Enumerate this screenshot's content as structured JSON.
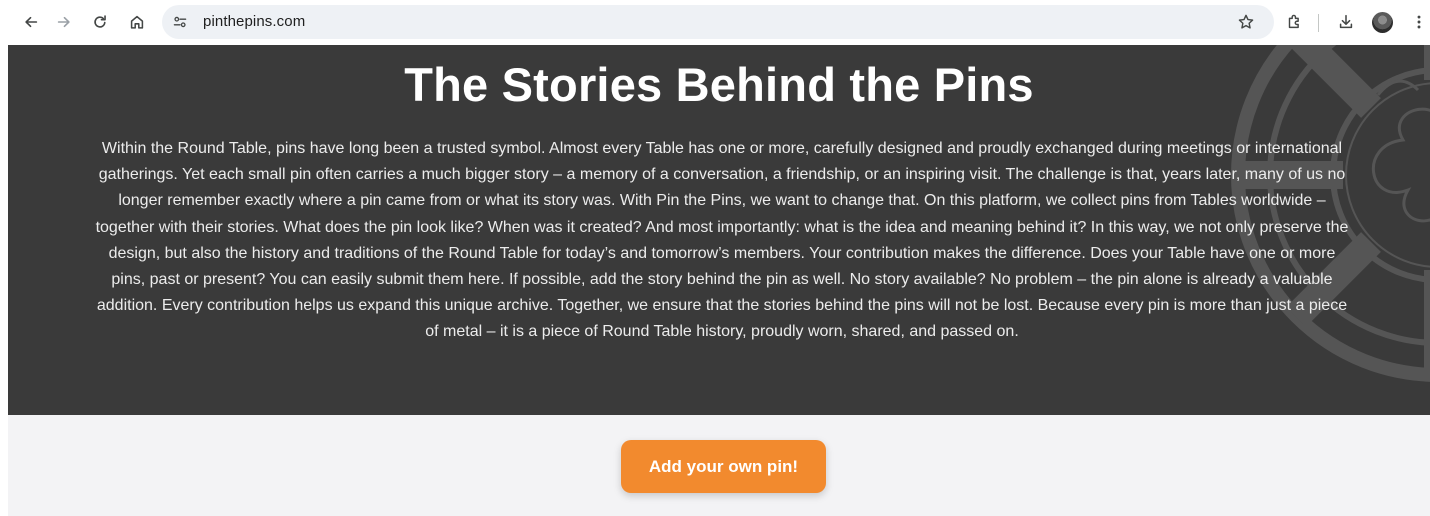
{
  "browser": {
    "url": "pinthepins.com",
    "icons": {
      "back": "arrow-left-icon",
      "forward": "arrow-right-icon",
      "reload": "reload-icon",
      "home": "home-icon",
      "site_info": "tune-icon",
      "bookmark": "star-icon",
      "extensions": "puzzle-icon",
      "downloads": "download-icon",
      "profile": "avatar",
      "menu": "kebab-menu-icon"
    }
  },
  "hero": {
    "title": "The Stories Behind the Pins",
    "body": "Within the Round Table, pins have long been a trusted symbol. Almost every Table has one or more, carefully designed and proudly exchanged during meetings or international gatherings. Yet each small pin often carries a much bigger story – a memory of a conversation, a friendship, or an inspiring visit. The challenge is that, years later, many of us no longer remember exactly where a pin came from or what its story was. With Pin the Pins, we want to change that. On this platform, we collect pins from Tables worldwide – together with their stories. What does the pin look like? When was it created? And most importantly: what is the idea and meaning behind it? In this way, we not only preserve the design, but also the history and traditions of the Round Table for today’s and tomorrow’s members. Your contribution makes the difference. Does your Table have one or more pins, past or present? You can easily submit them here. If possible, add the story behind the pin as well. No story available? No problem – the pin alone is already a valuable addition. Every contribution helps us expand this unique archive. Together, we ensure that the stories behind the pins will not be lost. Because every pin is more than just a piece of metal – it is a piece of Round Table history, proudly worn, shared, and passed on."
  },
  "cta": {
    "label": "Add your own pin!"
  },
  "colors": {
    "hero_background": "#3a3a3a",
    "lower_background": "#f3f3f5",
    "accent": "#f28a2e",
    "omnibox": "#eef1f5"
  }
}
